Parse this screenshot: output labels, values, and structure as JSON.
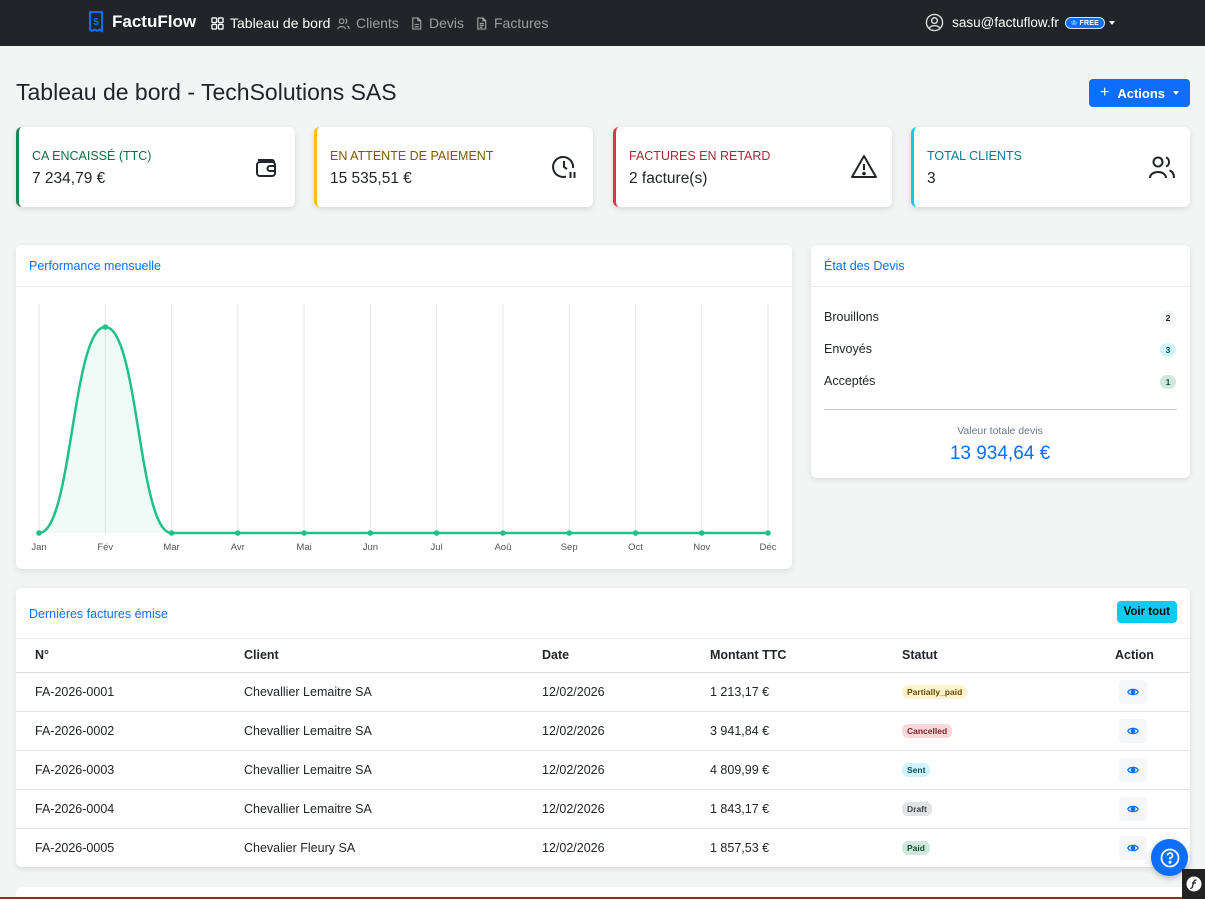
{
  "navbar": {
    "brand": "FactuFlow",
    "items": [
      {
        "label": "Tableau de bord",
        "icon": "dashboard-icon",
        "active": true
      },
      {
        "label": "Clients",
        "icon": "users-icon",
        "active": false
      },
      {
        "label": "Devis",
        "icon": "file-icon",
        "active": false
      },
      {
        "label": "Factures",
        "icon": "file-text-icon",
        "active": false
      }
    ],
    "user_email": "sasu@factuflow.fr",
    "plan_badge": "FREE"
  },
  "page": {
    "title": "Tableau de bord - TechSolutions SAS",
    "actions_label": "Actions"
  },
  "stats": [
    {
      "label": "CA ENCAISSÉ (TTC)",
      "value": "7 234,79 €",
      "color": "#198754",
      "icon": "wallet-icon"
    },
    {
      "label": "EN ATTENTE DE PAIEMENT",
      "value": "15 535,51 €",
      "color": "#ffc107",
      "icon": "clock-pause-icon"
    },
    {
      "label": "FACTURES EN RETARD",
      "value": "2 facture(s)",
      "color": "#dc3545",
      "icon": "warning-icon"
    },
    {
      "label": "TOTAL CLIENTS",
      "value": "3",
      "color": "#0dcaf0",
      "icon": "users-icon"
    }
  ],
  "performance": {
    "title": "Performance mensuelle",
    "chart_data": {
      "type": "area",
      "categories": [
        "Jan",
        "Fév",
        "Mar",
        "Avr",
        "Mai",
        "Jun",
        "Jul",
        "Aoû",
        "Sep",
        "Oct",
        "Nov",
        "Déc"
      ],
      "values": [
        0,
        7234.79,
        0,
        0,
        0,
        0,
        0,
        0,
        0,
        0,
        0,
        0
      ],
      "color": "#20c08a",
      "grid": "vertical"
    }
  },
  "devis": {
    "title": "État des Devis",
    "rows": [
      {
        "label": "Brouillons",
        "count": "2"
      },
      {
        "label": "Envoyés",
        "count": "3"
      },
      {
        "label": "Acceptés",
        "count": "1"
      }
    ],
    "total_label": "Valeur totale devis",
    "total_value": "13 934,64 €"
  },
  "invoices": {
    "title": "Dernières factures émise",
    "view_all": "Voir tout",
    "columns": [
      "N°",
      "Client",
      "Date",
      "Montant TTC",
      "Statut",
      "Action"
    ],
    "rows": [
      {
        "num": "FA-2026-0001",
        "client": "Chevallier Lemaitre SA",
        "date": "12/02/2026",
        "amount": "1 213,17 €",
        "status": "Partially_paid"
      },
      {
        "num": "FA-2026-0002",
        "client": "Chevallier Lemaitre SA",
        "date": "12/02/2026",
        "amount": "3 941,84 €",
        "status": "Cancelled"
      },
      {
        "num": "FA-2026-0003",
        "client": "Chevallier Lemaitre SA",
        "date": "12/02/2026",
        "amount": "4 809,99 €",
        "status": "Sent"
      },
      {
        "num": "FA-2026-0004",
        "client": "Chevallier Lemaitre SA",
        "date": "12/02/2026",
        "amount": "1 843,17 €",
        "status": "Draft"
      },
      {
        "num": "FA-2026-0005",
        "client": "Chevalier Fleury SA",
        "date": "12/02/2026",
        "amount": "1 857,53 €",
        "status": "Paid"
      }
    ]
  }
}
